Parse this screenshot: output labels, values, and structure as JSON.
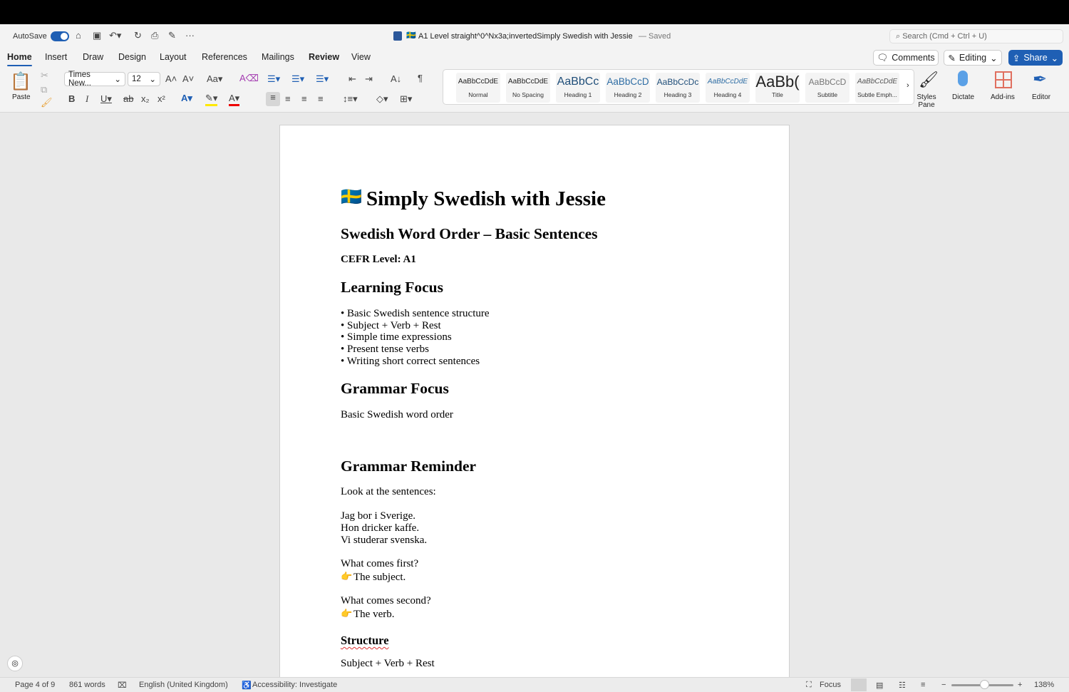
{
  "title_bar": {
    "autosave": "AutoSave",
    "doc_title": "A1 Level straight^0^Nx3a;invertedSimply Swedish with Jessie",
    "saved": "— Saved",
    "search_placeholder": "Search (Cmd + Ctrl + U)"
  },
  "tabs": [
    "Home",
    "Insert",
    "Draw",
    "Design",
    "Layout",
    "References",
    "Mailings",
    "Review",
    "View"
  ],
  "actions": {
    "comments": "Comments",
    "editing": "Editing",
    "share": "Share"
  },
  "ribbon": {
    "paste": "Paste",
    "font": "Times New...",
    "size": "12",
    "styles": [
      {
        "preview": "AaBbCcDdE",
        "name": "Normal"
      },
      {
        "preview": "AaBbCcDdE",
        "name": "No Spacing"
      },
      {
        "preview": "AaBbCc",
        "name": "Heading 1"
      },
      {
        "preview": "AaBbCcD",
        "name": "Heading 2"
      },
      {
        "preview": "AaBbCcDc",
        "name": "Heading 3"
      },
      {
        "preview": "AaBbCcDdE",
        "name": "Heading 4"
      },
      {
        "preview": "AaBb(",
        "name": "Title"
      },
      {
        "preview": "AaBbCcD",
        "name": "Subtitle"
      },
      {
        "preview": "AaBbCcDdE",
        "name": "Subtle Emph..."
      }
    ],
    "styles_pane": "Styles Pane",
    "dictate": "Dictate",
    "addins": "Add-ins",
    "editor": "Editor"
  },
  "doc": {
    "title": "Simply Swedish with Jessie",
    "flag": "🇸🇪",
    "subtitle": "Swedish Word Order – Basic Sentences",
    "level": "CEFR Level: A1",
    "learning_heading": "Learning Focus",
    "bullets": [
      "• Basic Swedish sentence structure",
      "• Subject + Verb + Rest",
      "• Simple time expressions",
      "• Present tense verbs",
      "• Writing short correct sentences"
    ],
    "grammar_heading": "Grammar Focus",
    "grammar_text": "Basic Swedish word order",
    "reminder_heading": "Grammar Reminder",
    "look": "Look at the sentences:",
    "sentences": [
      "Jag bor i Sverige.",
      "Hon dricker kaffe.",
      "Vi studerar svenska."
    ],
    "q1": "What comes first?",
    "a1": "The subject.",
    "q2": "What comes second?",
    "a2": "The verb.",
    "pointer": "👉",
    "structure_heading": "Structure",
    "structure_text": "Subject + Verb + Rest"
  },
  "status": {
    "page": "Page 4 of 9",
    "words": "861 words",
    "language": "English (United Kingdom)",
    "accessibility": "Accessibility: Investigate",
    "focus": "Focus",
    "zoom": "138%",
    "zoom_level": 138
  }
}
